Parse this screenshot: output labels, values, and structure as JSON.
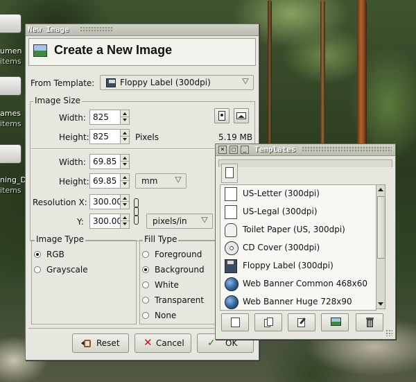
{
  "desktop": {
    "icons": [
      {
        "label": "umen",
        "sub": "items"
      },
      {
        "label": "ames",
        "sub": "items"
      },
      {
        "label": "ning_D",
        "sub": "items"
      }
    ]
  },
  "new_image_dialog": {
    "window_title": "New Image",
    "header_title": "Create a New Image",
    "from_template_label": "From Template:",
    "template_selected": "Floppy Label (300dpi)",
    "image_size": {
      "frame_title": "Image Size",
      "width_label": "Width:",
      "width_value": "825",
      "height_label": "Height:",
      "height_value": "825",
      "units": "Pixels",
      "file_size": "5.19 MB",
      "phys_width_label": "Width:",
      "phys_width_value": "69.85",
      "phys_height_label": "Height:",
      "phys_height_value": "69.85",
      "phys_unit": "mm",
      "res_x_label": "Resolution X:",
      "res_x_value": "300.000",
      "res_y_label": "Y:",
      "res_y_value": "300.000",
      "res_unit": "pixels/in"
    },
    "image_type": {
      "frame_title": "Image Type",
      "options": [
        "RGB",
        "Grayscale"
      ],
      "selected": "RGB"
    },
    "fill_type": {
      "frame_title": "Fill Type",
      "options": [
        "Foreground",
        "Background",
        "White",
        "Transparent",
        "None"
      ],
      "selected": "Background"
    },
    "buttons": {
      "reset": "Reset",
      "cancel": "Cancel",
      "ok": "OK"
    }
  },
  "templates_window": {
    "window_title": "Templates",
    "items": [
      {
        "label": "US-Letter (300dpi)",
        "icon": "page-icon"
      },
      {
        "label": "US-Legal (300dpi)",
        "icon": "page-icon"
      },
      {
        "label": "Toilet Paper (US, 300dpi)",
        "icon": "toilet-paper-icon"
      },
      {
        "label": "CD Cover (300dpi)",
        "icon": "cd-icon"
      },
      {
        "label": "Floppy Label (300dpi)",
        "icon": "floppy-icon"
      },
      {
        "label": "Web Banner Common 468x60",
        "icon": "globe-icon"
      },
      {
        "label": "Web Banner Huge 728x90",
        "icon": "globe-icon"
      }
    ],
    "toolbar": [
      "new-template-icon",
      "duplicate-template-icon",
      "edit-template-icon",
      "create-image-icon",
      "delete-template-icon"
    ]
  }
}
